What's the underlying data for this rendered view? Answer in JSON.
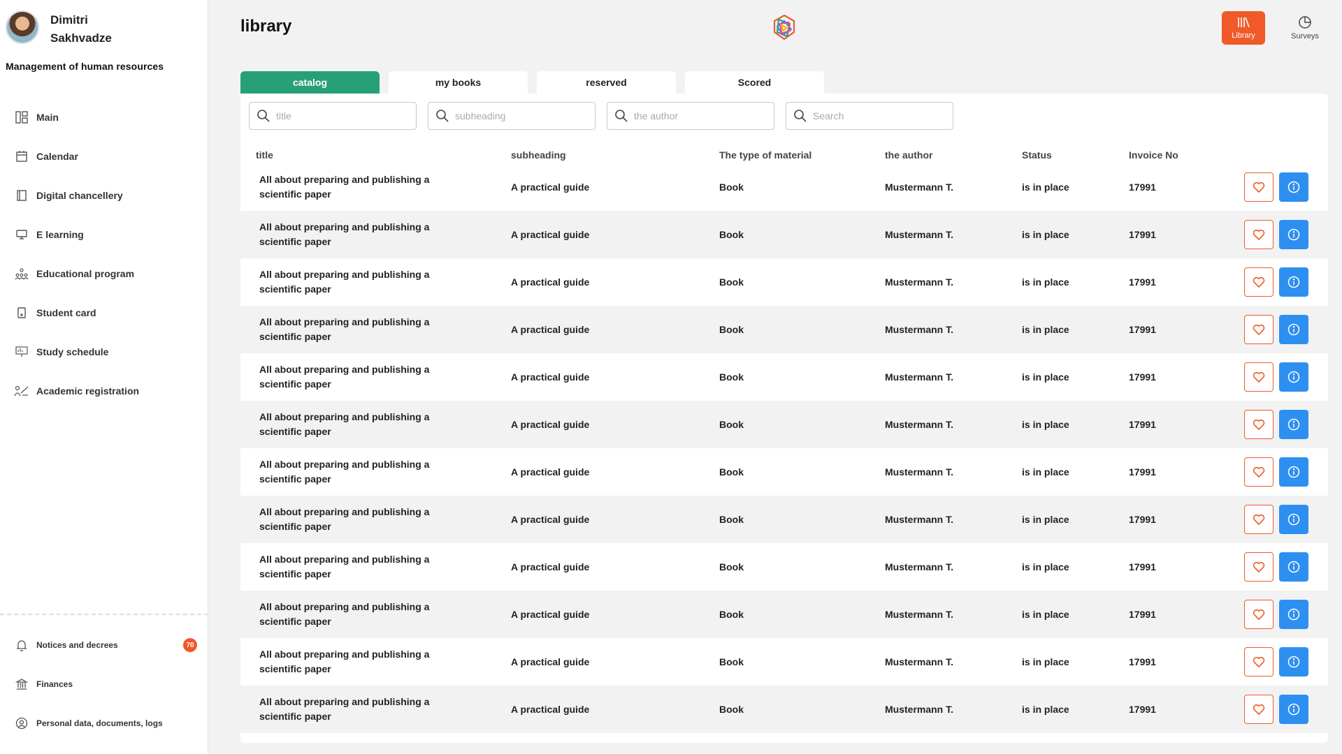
{
  "user": {
    "name": "Dimitri Sakhvadze",
    "org": "Management of human resources"
  },
  "sidebar": {
    "items": [
      {
        "label": "Main",
        "icon": "dashboard-icon"
      },
      {
        "label": "Calendar",
        "icon": "calendar-icon"
      },
      {
        "label": "Digital chancellery",
        "icon": "book-icon"
      },
      {
        "label": "E learning",
        "icon": "monitor-icon"
      },
      {
        "label": "Educational program",
        "icon": "people-icon"
      },
      {
        "label": "Student card",
        "icon": "card-icon"
      },
      {
        "label": "Study schedule",
        "icon": "presentation-icon"
      },
      {
        "label": "Academic registration",
        "icon": "registration-icon"
      }
    ],
    "bottom": [
      {
        "label": "Notices and decrees",
        "icon": "bell-icon",
        "badge": "70"
      },
      {
        "label": "Finances",
        "icon": "bank-icon"
      },
      {
        "label": "Personal data, documents, logs",
        "icon": "user-circle-icon"
      }
    ]
  },
  "header": {
    "title": "library",
    "buttons": [
      {
        "label": "Library",
        "icon": "library-icon",
        "active": true
      },
      {
        "label": "Surveys",
        "icon": "pie-chart-icon",
        "active": false
      }
    ]
  },
  "tabs": [
    {
      "label": "catalog",
      "active": true
    },
    {
      "label": "my books",
      "active": false
    },
    {
      "label": "reserved",
      "active": false
    },
    {
      "label": "Scored",
      "active": false
    }
  ],
  "filters": [
    {
      "placeholder": "title"
    },
    {
      "placeholder": "subheading"
    },
    {
      "placeholder": "the author"
    },
    {
      "placeholder": "Search"
    }
  ],
  "table": {
    "columns": [
      "title",
      "subheading",
      "The type of material",
      "the author",
      "Status",
      "Invoice No"
    ],
    "rows": [
      {
        "title": "All about preparing and publishing a scientific paper",
        "subheading": "A practical guide",
        "type": "Book",
        "author": "Mustermann T.",
        "status": "is in place",
        "invoice": "17991"
      },
      {
        "title": "All about preparing and publishing a scientific paper",
        "subheading": "A practical guide",
        "type": "Book",
        "author": "Mustermann T.",
        "status": "is in place",
        "invoice": "17991"
      },
      {
        "title": "All about preparing and publishing a scientific paper",
        "subheading": "A practical guide",
        "type": "Book",
        "author": "Mustermann T.",
        "status": "is in place",
        "invoice": "17991"
      },
      {
        "title": "All about preparing and publishing a scientific paper",
        "subheading": "A practical guide",
        "type": "Book",
        "author": "Mustermann T.",
        "status": "is in place",
        "invoice": "17991"
      },
      {
        "title": "All about preparing and publishing a scientific paper",
        "subheading": "A practical guide",
        "type": "Book",
        "author": "Mustermann T.",
        "status": "is in place",
        "invoice": "17991"
      },
      {
        "title": "All about preparing and publishing a scientific paper",
        "subheading": "A practical guide",
        "type": "Book",
        "author": "Mustermann T.",
        "status": "is in place",
        "invoice": "17991"
      },
      {
        "title": "All about preparing and publishing a scientific paper",
        "subheading": "A practical guide",
        "type": "Book",
        "author": "Mustermann T.",
        "status": "is in place",
        "invoice": "17991"
      },
      {
        "title": "All about preparing and publishing a scientific paper",
        "subheading": "A practical guide",
        "type": "Book",
        "author": "Mustermann T.",
        "status": "is in place",
        "invoice": "17991"
      },
      {
        "title": "All about preparing and publishing a scientific paper",
        "subheading": "A practical guide",
        "type": "Book",
        "author": "Mustermann T.",
        "status": "is in place",
        "invoice": "17991"
      },
      {
        "title": "All about preparing and publishing a scientific paper",
        "subheading": "A practical guide",
        "type": "Book",
        "author": "Mustermann T.",
        "status": "is in place",
        "invoice": "17991"
      },
      {
        "title": "All about preparing and publishing a scientific paper",
        "subheading": "A practical guide",
        "type": "Book",
        "author": "Mustermann T.",
        "status": "is in place",
        "invoice": "17991"
      },
      {
        "title": "All about preparing and publishing a scientific paper",
        "subheading": "A practical guide",
        "type": "Book",
        "author": "Mustermann T.",
        "status": "is in place",
        "invoice": "17991"
      }
    ]
  },
  "colors": {
    "accent": "#f05a28",
    "tab_active": "#27a07a",
    "info": "#2d8ff0"
  }
}
